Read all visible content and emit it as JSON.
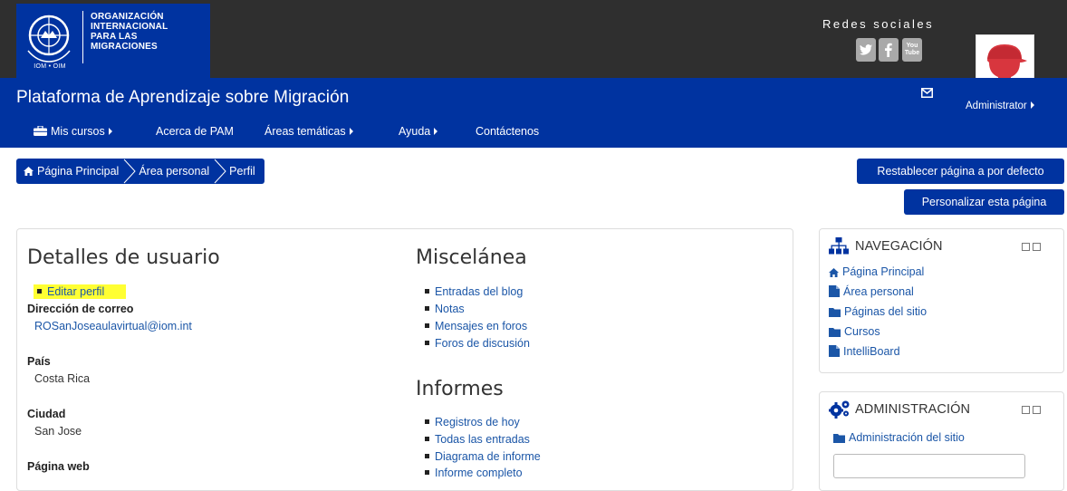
{
  "logo": {
    "lines": [
      "ORGANIZACIÓN",
      "INTERNACIONAL",
      "PARA LAS",
      "MIGRACIONES"
    ],
    "abbr": "IOM • OIM"
  },
  "social": {
    "title": "Redes sociales",
    "icons": [
      "twitter-icon",
      "facebook-icon",
      "youtube-icon"
    ],
    "youtube_text": "You Tube"
  },
  "site": {
    "title": "Plataforma de Aprendizaje sobre Migración",
    "user_name": "Administrator"
  },
  "nav": {
    "items": [
      "Mis cursos",
      "Acerca de PAM",
      "Áreas temáticas",
      "Ayuda",
      "Contáctenos"
    ]
  },
  "breadcrumb": [
    "Página Principal",
    "Área personal",
    "Perfil"
  ],
  "buttons": {
    "reset": "Restablecer página a por defecto",
    "customize": "Personalizar esta página"
  },
  "user_details": {
    "heading": "Detalles de usuario",
    "edit_profile": "Editar perfil",
    "email_label": "Dirección de correo",
    "email_value": "ROSanJoseaulavirtual@iom.int",
    "country_label": "País",
    "country_value": "Costa Rica",
    "city_label": "Ciudad",
    "city_value": "San Jose",
    "web_label": "Página web"
  },
  "misc": {
    "heading": "Miscelánea",
    "items": [
      "Entradas del blog",
      "Notas",
      "Mensajes en foros",
      "Foros de discusión"
    ]
  },
  "reports": {
    "heading": "Informes",
    "items": [
      "Registros de hoy",
      "Todas las entradas",
      "Diagrama de informe",
      "Informe completo"
    ]
  },
  "navigation_block": {
    "title": "NAVEGACIÓN",
    "items": [
      "Página Principal",
      "Área personal",
      "Páginas del sitio",
      "Cursos",
      "IntelliBoard"
    ]
  },
  "admin_block": {
    "title": "ADMINISTRACIÓN",
    "items": [
      "Administración del sitio"
    ]
  },
  "colors": {
    "brand_blue": "#0033a0",
    "header_dark": "#2f2f2f",
    "link": "#1b56a7",
    "highlight": "#ffff33"
  }
}
